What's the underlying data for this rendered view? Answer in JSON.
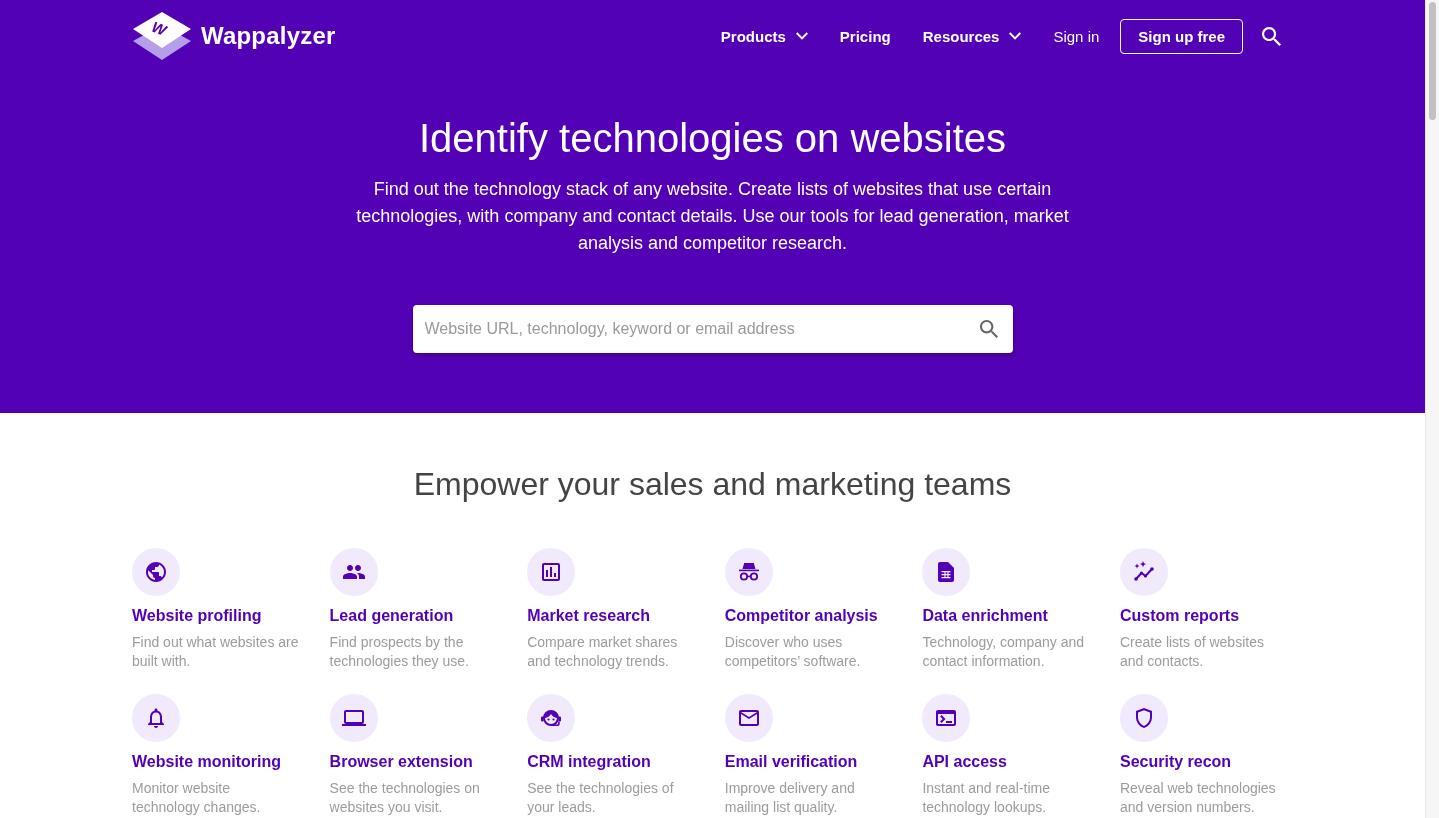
{
  "logo": {
    "mark": "W",
    "name": "Wappalyzer"
  },
  "nav": {
    "items": [
      {
        "label": "Products",
        "kind": "menu"
      },
      {
        "label": "Pricing",
        "kind": "link"
      },
      {
        "label": "Resources",
        "kind": "menu"
      },
      {
        "label": "Sign in",
        "kind": "plain"
      },
      {
        "label": "Sign up free",
        "kind": "button"
      }
    ]
  },
  "hero": {
    "title": "Identify technologies on websites",
    "description": "Find out the technology stack of any website. Create lists of websites that use certain technologies, with company and contact details. Use our tools for lead generation, market analysis and competitor research.",
    "search": {
      "placeholder": "Website URL, technology, keyword or email address"
    }
  },
  "features": {
    "title": "Empower your sales and marketing teams",
    "items": [
      {
        "title": "Website profiling",
        "description": "Find out what websites are built with."
      },
      {
        "title": "Lead generation",
        "description": "Find prospects by the technologies they use."
      },
      {
        "title": "Market research",
        "description": "Compare market shares and technology trends."
      },
      {
        "title": "Competitor analysis",
        "description": "Discover who uses competitors’ software."
      },
      {
        "title": "Data enrichment",
        "description": "Technology, company and contact information."
      },
      {
        "title": "Custom reports",
        "description": "Create lists of websites and contacts."
      },
      {
        "title": "Website monitoring",
        "description": "Monitor website technology changes."
      },
      {
        "title": "Browser extension",
        "description": "See the technologies on websites you visit."
      },
      {
        "title": "CRM integration",
        "description": "See the technologies of your leads."
      },
      {
        "title": "Email verification",
        "description": "Improve delivery and mailing list quality."
      },
      {
        "title": "API access",
        "description": "Instant and real-time technology lookups."
      },
      {
        "title": "Security recon",
        "description": "Reveal web technologies and version numbers."
      }
    ]
  }
}
